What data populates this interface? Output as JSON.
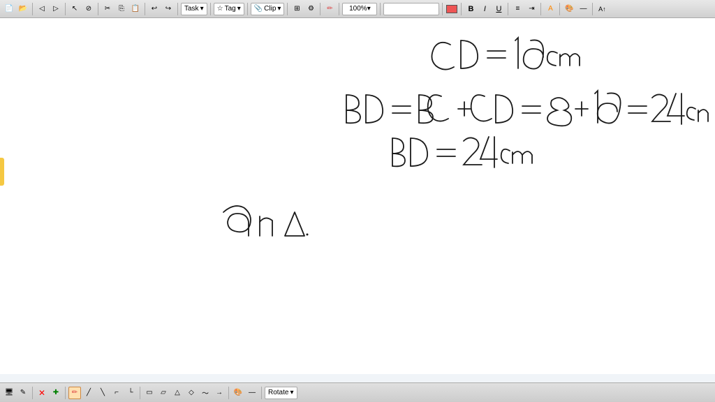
{
  "toolbar": {
    "items": [
      {
        "label": "↩",
        "name": "undo-icon"
      },
      {
        "label": "↪",
        "name": "redo-icon"
      },
      {
        "label": "✂",
        "name": "cut-icon"
      },
      {
        "label": "⎘",
        "name": "copy-icon"
      },
      {
        "label": "⬕",
        "name": "paste-icon"
      },
      {
        "label": "Task",
        "name": "task-dropdown",
        "has_arrow": true
      },
      {
        "label": "Tag",
        "name": "tag-dropdown",
        "has_arrow": true
      },
      {
        "label": "Clip",
        "name": "clip-dropdown",
        "has_arrow": true
      }
    ],
    "zoom": "100%",
    "bold_label": "B",
    "italic_label": "I",
    "underline_label": "U",
    "rotate_label": "Rotate"
  },
  "canvas": {
    "background": "#ffffff",
    "equation1": "CD = 16 cm",
    "equation2": "BD = BC + CD = 8 + 16 = 24 cm",
    "equation3": "BD = 24 cm",
    "partial_text": "9n  Δ"
  },
  "bottom_toolbar": {
    "rotate_label": "Rotate"
  }
}
